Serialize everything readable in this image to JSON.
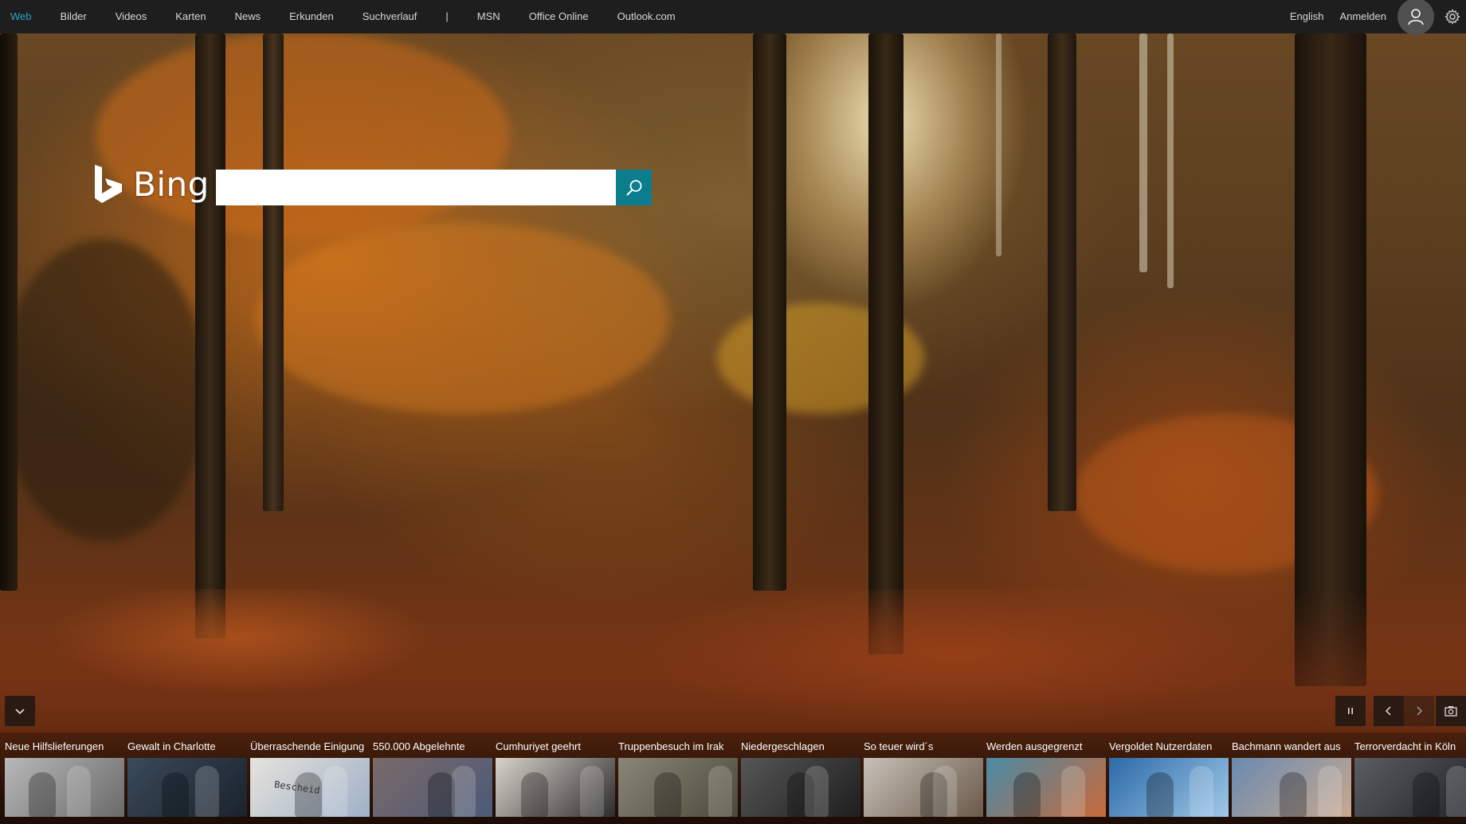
{
  "nav": {
    "items": [
      {
        "label": "Web",
        "active": true
      },
      {
        "label": "Bilder"
      },
      {
        "label": "Videos"
      },
      {
        "label": "Karten"
      },
      {
        "label": "News"
      },
      {
        "label": "Erkunden"
      },
      {
        "label": "Suchverlauf"
      }
    ],
    "separator": "|",
    "extra": [
      {
        "label": "MSN"
      },
      {
        "label": "Office Online"
      },
      {
        "label": "Outlook.com"
      }
    ]
  },
  "header": {
    "language": "English",
    "signin": "Anmelden",
    "avatar_icon": "user-icon",
    "settings_icon": "gear-icon"
  },
  "logo": {
    "text": "Bing",
    "icon": "bing-b-icon"
  },
  "search": {
    "value": "",
    "placeholder": "",
    "button_icon": "search-icon",
    "accent": "#0b7d8c"
  },
  "controls": {
    "expand_icon": "chevron-down-icon",
    "pause_icon": "pause-icon",
    "prev_icon": "chevron-left-icon",
    "next_icon": "chevron-right-icon",
    "camera_icon": "camera-icon"
  },
  "news": [
    {
      "title": "Neue Hilfslieferungen",
      "color": "#b8b8b8",
      "accent": "#6a6a6a"
    },
    {
      "title": "Gewalt in Charlotte",
      "color": "#3a4a5a",
      "accent": "#1a222c"
    },
    {
      "title": "Überraschende Einigung",
      "color": "#e6e3dc",
      "accent": "#9fb0c8",
      "thumb_text": "Bescheid"
    },
    {
      "title": "550.000 Abgelehnte",
      "color": "#7a6a68",
      "accent": "#4c5a78"
    },
    {
      "title": "Cumhuriyet geehrt",
      "color": "#d8d4cc",
      "accent": "#2c2c2c"
    },
    {
      "title": "Truppenbesuch im Irak",
      "color": "#8a8678",
      "accent": "#4a4a3a"
    },
    {
      "title": "Niedergeschlagen",
      "color": "#565656",
      "accent": "#1e1e1e"
    },
    {
      "title": "So teuer wird´s",
      "color": "#c8c0b8",
      "accent": "#6a5a4a"
    },
    {
      "title": "Werden ausgegrenzt",
      "color": "#4a8aa8",
      "accent": "#c86a3a"
    },
    {
      "title": "Vergoldet Nutzerdaten",
      "color": "#2c6aa8",
      "accent": "#9fc8e8"
    },
    {
      "title": "Bachmann wandert aus",
      "color": "#6a8ab0",
      "accent": "#c8a890"
    },
    {
      "title": "Terrorverdacht in Köln",
      "color": "#5a5e62",
      "accent": "#202428"
    }
  ]
}
